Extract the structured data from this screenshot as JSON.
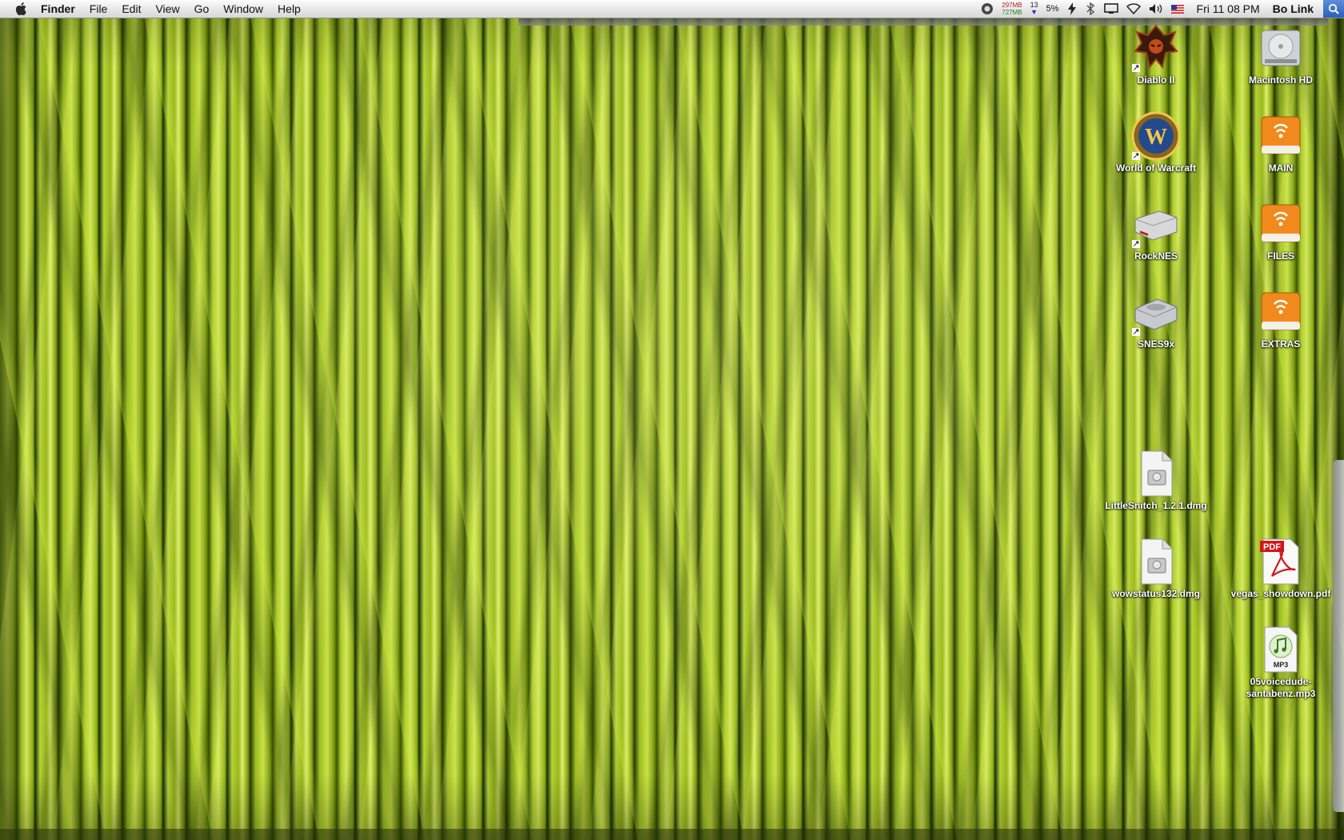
{
  "menubar": {
    "apple_icon": "apple-logo",
    "app_name": "Finder",
    "menus": [
      "File",
      "Edit",
      "View",
      "Go",
      "Window",
      "Help"
    ],
    "status": {
      "mem_top": "297MB",
      "mem_bottom": "727MB",
      "count": "13",
      "percent": "5%",
      "clock": "Fri 11 08 PM",
      "user": "Bo Link"
    }
  },
  "desktop_icons": [
    {
      "label": "Diablo II",
      "icon": "diablo-icon"
    },
    {
      "label": "Macintosh HD",
      "icon": "hard-drive-icon"
    },
    {
      "label": "World of Warcraft",
      "icon": "warcraft-icon"
    },
    {
      "label": "MAIN",
      "icon": "network-drive-icon"
    },
    {
      "label": "RockNES",
      "icon": "nes-console-icon"
    },
    {
      "label": "FILES",
      "icon": "network-drive-icon"
    },
    {
      "label": "SNES9x",
      "icon": "snes-console-icon"
    },
    {
      "label": "EXTRAS",
      "icon": "network-drive-icon"
    },
    {
      "label": "LittleSnitch_1.2.1.dmg",
      "icon": "disk-image-icon"
    },
    {
      "label": "wowstatus132.dmg",
      "icon": "disk-image-icon"
    },
    {
      "label": "vegas_showdown.pdf",
      "icon": "pdf-document-icon"
    },
    {
      "label": "05voicedude-santabenz.mp3",
      "icon": "mp3-file-icon"
    }
  ],
  "pdf_badge": "PDF",
  "mp3_badge": "MP3",
  "colors": {
    "grass_light": "#c9e04a",
    "grass_dark": "#3c5406",
    "drive_orange": "#f08a1c",
    "pdf_red": "#d01818"
  }
}
